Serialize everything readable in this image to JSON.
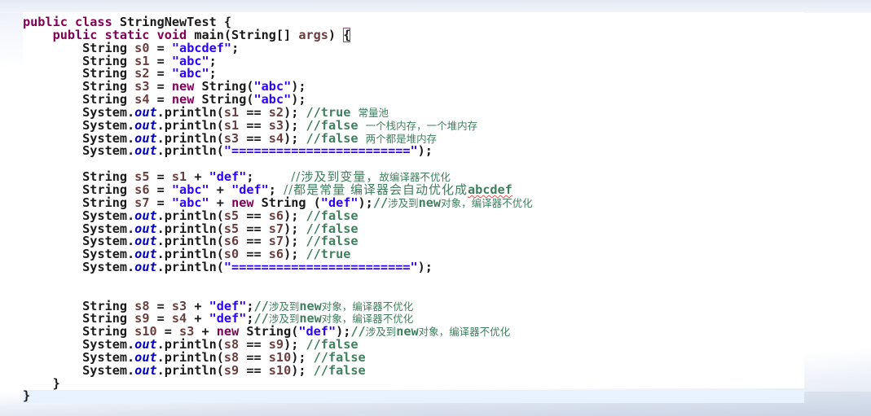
{
  "editor": {
    "language": "java",
    "current_line_index": 29,
    "lines": [
      {
        "indent": "",
        "tokens": [
          [
            "kw",
            "public class "
          ],
          [
            "plain",
            "StringNewTest {"
          ]
        ]
      },
      {
        "indent": "    ",
        "tokens": [
          [
            "kw",
            "public static void "
          ],
          [
            "plain",
            "main(String[] "
          ],
          [
            "var",
            "args"
          ],
          [
            "plain",
            ") "
          ],
          [
            "bracket",
            "{"
          ]
        ]
      },
      {
        "indent": "        ",
        "tokens": [
          [
            "plain",
            "String "
          ],
          [
            "var",
            "s0"
          ],
          [
            "plain",
            " = "
          ],
          [
            "str",
            "\"abcdef\""
          ],
          [
            "plain",
            ";"
          ]
        ]
      },
      {
        "indent": "        ",
        "tokens": [
          [
            "plain",
            "String "
          ],
          [
            "var",
            "s1"
          ],
          [
            "plain",
            " = "
          ],
          [
            "str",
            "\"abc\""
          ],
          [
            "plain",
            ";"
          ]
        ]
      },
      {
        "indent": "        ",
        "tokens": [
          [
            "plain",
            "String "
          ],
          [
            "var",
            "s2"
          ],
          [
            "plain",
            " = "
          ],
          [
            "str",
            "\"abc\""
          ],
          [
            "plain",
            ";"
          ]
        ]
      },
      {
        "indent": "        ",
        "tokens": [
          [
            "plain",
            "String "
          ],
          [
            "var",
            "s3"
          ],
          [
            "plain",
            " = "
          ],
          [
            "kw",
            "new "
          ],
          [
            "plain",
            "String("
          ],
          [
            "str",
            "\"abc\""
          ],
          [
            "plain",
            ");"
          ]
        ]
      },
      {
        "indent": "        ",
        "tokens": [
          [
            "plain",
            "String "
          ],
          [
            "var",
            "s4"
          ],
          [
            "plain",
            " = "
          ],
          [
            "kw",
            "new "
          ],
          [
            "plain",
            "String("
          ],
          [
            "str",
            "\"abc\""
          ],
          [
            "plain",
            ");"
          ]
        ]
      },
      {
        "indent": "        ",
        "tokens": [
          [
            "plain",
            "System."
          ],
          [
            "fld",
            "out"
          ],
          [
            "plain",
            ".println("
          ],
          [
            "var",
            "s1"
          ],
          [
            "plain",
            " == "
          ],
          [
            "var",
            "s2"
          ],
          [
            "plain",
            "); "
          ],
          [
            "cmt",
            "//true "
          ],
          [
            "cmtcjk",
            "常量池"
          ]
        ]
      },
      {
        "indent": "        ",
        "tokens": [
          [
            "plain",
            "System."
          ],
          [
            "fld",
            "out"
          ],
          [
            "plain",
            ".println("
          ],
          [
            "var",
            "s1"
          ],
          [
            "plain",
            " == "
          ],
          [
            "var",
            "s3"
          ],
          [
            "plain",
            "); "
          ],
          [
            "cmt",
            "//false "
          ],
          [
            "cmtcjk",
            "一个栈内存，一个堆内存"
          ]
        ]
      },
      {
        "indent": "        ",
        "tokens": [
          [
            "plain",
            "System."
          ],
          [
            "fld",
            "out"
          ],
          [
            "plain",
            ".println("
          ],
          [
            "var",
            "s3"
          ],
          [
            "plain",
            " == "
          ],
          [
            "var",
            "s4"
          ],
          [
            "plain",
            "); "
          ],
          [
            "cmt",
            "//false "
          ],
          [
            "cmtcjk",
            "两个都是堆内存"
          ]
        ]
      },
      {
        "indent": "        ",
        "tokens": [
          [
            "plain",
            "System."
          ],
          [
            "fld",
            "out"
          ],
          [
            "plain",
            ".println("
          ],
          [
            "str",
            "\"========================\""
          ],
          [
            "plain",
            ");"
          ]
        ]
      },
      {
        "indent": "",
        "tokens": []
      },
      {
        "indent": "        ",
        "tokens": [
          [
            "plain",
            "String "
          ],
          [
            "var",
            "s5"
          ],
          [
            "plain",
            " = "
          ],
          [
            "var",
            "s1"
          ],
          [
            "plain",
            " + "
          ],
          [
            "str",
            "\"def\""
          ],
          [
            "plain",
            ";     "
          ],
          [
            "cmtbig",
            "//涉及到变量，"
          ],
          [
            "cmtcjk",
            "故编译器不优化"
          ]
        ]
      },
      {
        "indent": "        ",
        "tokens": [
          [
            "plain",
            "String "
          ],
          [
            "var",
            "s6"
          ],
          [
            "plain",
            " = "
          ],
          [
            "str",
            "\"abc\""
          ],
          [
            "plain",
            " + "
          ],
          [
            "str",
            "\"def\""
          ],
          [
            "plain",
            "; "
          ],
          [
            "cmtbig",
            "//都是常量 编译器会自动优化成"
          ],
          [
            "cmtsquiggle",
            "abcdef"
          ]
        ]
      },
      {
        "indent": "        ",
        "tokens": [
          [
            "plain",
            "String "
          ],
          [
            "var",
            "s7"
          ],
          [
            "plain",
            " = "
          ],
          [
            "str",
            "\"abc\""
          ],
          [
            "plain",
            " + "
          ],
          [
            "kw",
            "new "
          ],
          [
            "plain",
            "String ("
          ],
          [
            "str",
            "\"def\""
          ],
          [
            "plain",
            ");"
          ],
          [
            "cmt",
            "//"
          ],
          [
            "cmtcjk",
            "涉及到"
          ],
          [
            "cmt",
            "new"
          ],
          [
            "cmtcjk",
            "对象，编译器不优化"
          ]
        ]
      },
      {
        "indent": "        ",
        "tokens": [
          [
            "plain",
            "System."
          ],
          [
            "fld",
            "out"
          ],
          [
            "plain",
            ".println("
          ],
          [
            "var",
            "s5"
          ],
          [
            "plain",
            " == "
          ],
          [
            "var",
            "s6"
          ],
          [
            "plain",
            "); "
          ],
          [
            "cmt",
            "//false"
          ]
        ]
      },
      {
        "indent": "        ",
        "tokens": [
          [
            "plain",
            "System."
          ],
          [
            "fld",
            "out"
          ],
          [
            "plain",
            ".println("
          ],
          [
            "var",
            "s5"
          ],
          [
            "plain",
            " == "
          ],
          [
            "var",
            "s7"
          ],
          [
            "plain",
            "); "
          ],
          [
            "cmt",
            "//false"
          ]
        ]
      },
      {
        "indent": "        ",
        "tokens": [
          [
            "plain",
            "System."
          ],
          [
            "fld",
            "out"
          ],
          [
            "plain",
            ".println("
          ],
          [
            "var",
            "s6"
          ],
          [
            "plain",
            " == "
          ],
          [
            "var",
            "s7"
          ],
          [
            "plain",
            "); "
          ],
          [
            "cmt",
            "//false"
          ]
        ]
      },
      {
        "indent": "        ",
        "tokens": [
          [
            "plain",
            "System."
          ],
          [
            "fld",
            "out"
          ],
          [
            "plain",
            ".println("
          ],
          [
            "var",
            "s0"
          ],
          [
            "plain",
            " == "
          ],
          [
            "var",
            "s6"
          ],
          [
            "plain",
            "); "
          ],
          [
            "cmt",
            "//true"
          ]
        ]
      },
      {
        "indent": "        ",
        "tokens": [
          [
            "plain",
            "System."
          ],
          [
            "fld",
            "out"
          ],
          [
            "plain",
            ".println("
          ],
          [
            "str",
            "\"========================\""
          ],
          [
            "plain",
            ");"
          ]
        ]
      },
      {
        "indent": "",
        "tokens": []
      },
      {
        "indent": "",
        "tokens": []
      },
      {
        "indent": "        ",
        "tokens": [
          [
            "plain",
            "String "
          ],
          [
            "var",
            "s8"
          ],
          [
            "plain",
            " = "
          ],
          [
            "var",
            "s3"
          ],
          [
            "plain",
            " + "
          ],
          [
            "str",
            "\"def\""
          ],
          [
            "plain",
            ";"
          ],
          [
            "cmt",
            "//"
          ],
          [
            "cmtcjk",
            "涉及到"
          ],
          [
            "cmt",
            "new"
          ],
          [
            "cmtcjk",
            "对象，编译器不优化"
          ]
        ]
      },
      {
        "indent": "        ",
        "tokens": [
          [
            "plain",
            "String "
          ],
          [
            "var",
            "s9"
          ],
          [
            "plain",
            " = "
          ],
          [
            "var",
            "s4"
          ],
          [
            "plain",
            " + "
          ],
          [
            "str",
            "\"def\""
          ],
          [
            "plain",
            ";"
          ],
          [
            "cmt",
            "//"
          ],
          [
            "cmtcjk",
            "涉及到"
          ],
          [
            "cmt",
            "new"
          ],
          [
            "cmtcjk",
            "对象，编译器不优化"
          ]
        ]
      },
      {
        "indent": "        ",
        "tokens": [
          [
            "plain",
            "String "
          ],
          [
            "var",
            "s10"
          ],
          [
            "plain",
            " = "
          ],
          [
            "var",
            "s3"
          ],
          [
            "plain",
            " + "
          ],
          [
            "kw",
            "new "
          ],
          [
            "plain",
            "String("
          ],
          [
            "str",
            "\"def\""
          ],
          [
            "plain",
            ");"
          ],
          [
            "cmt",
            "//"
          ],
          [
            "cmtcjk",
            "涉及到"
          ],
          [
            "cmt",
            "new"
          ],
          [
            "cmtcjk",
            "对象，编译器不优化"
          ]
        ]
      },
      {
        "indent": "        ",
        "tokens": [
          [
            "plain",
            "System."
          ],
          [
            "fld",
            "out"
          ],
          [
            "plain",
            ".println("
          ],
          [
            "var",
            "s8"
          ],
          [
            "plain",
            " == "
          ],
          [
            "var",
            "s9"
          ],
          [
            "plain",
            "); "
          ],
          [
            "cmt",
            "//false"
          ]
        ]
      },
      {
        "indent": "        ",
        "tokens": [
          [
            "plain",
            "System."
          ],
          [
            "fld",
            "out"
          ],
          [
            "plain",
            ".println("
          ],
          [
            "var",
            "s8"
          ],
          [
            "plain",
            " == "
          ],
          [
            "var",
            "s10"
          ],
          [
            "plain",
            "); "
          ],
          [
            "cmt",
            "//false"
          ]
        ]
      },
      {
        "indent": "        ",
        "tokens": [
          [
            "plain",
            "System."
          ],
          [
            "fld",
            "out"
          ],
          [
            "plain",
            ".println("
          ],
          [
            "var",
            "s9"
          ],
          [
            "plain",
            " == "
          ],
          [
            "var",
            "s10"
          ],
          [
            "plain",
            "); "
          ],
          [
            "cmt",
            "//false"
          ]
        ]
      },
      {
        "indent": "    ",
        "tokens": [
          [
            "plain",
            "}"
          ]
        ]
      },
      {
        "indent": "",
        "tokens": [
          [
            "plain",
            "}"
          ]
        ]
      }
    ]
  },
  "colors": {
    "keyword": "#7f0055",
    "string": "#2a00ff",
    "local_variable": "#6a3e3e",
    "static_field": "#0000c0",
    "comment": "#3f7f5f",
    "current_line": "#e8f2fe"
  }
}
